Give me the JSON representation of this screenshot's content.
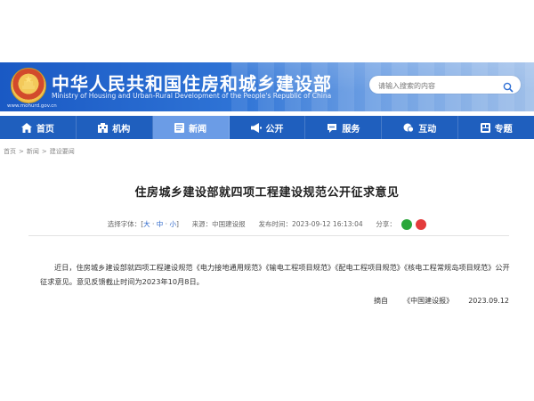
{
  "header": {
    "site_title": "中华人民共和国住房和城乡建设部",
    "site_subtitle": "Ministry of Housing and Urban-Rural Development of the People's Republic of China",
    "site_url": "www.mohurd.gov.cn",
    "search_placeholder": "请输入搜索的内容",
    "search_icon": "search-icon"
  },
  "nav": {
    "items": [
      {
        "label": "首页",
        "icon": "home-icon"
      },
      {
        "label": "机构",
        "icon": "building-icon"
      },
      {
        "label": "新闻",
        "icon": "news-icon",
        "active": true
      },
      {
        "label": "公开",
        "icon": "megaphone-icon"
      },
      {
        "label": "服务",
        "icon": "service-icon"
      },
      {
        "label": "互动",
        "icon": "chat-icon"
      },
      {
        "label": "专题",
        "icon": "topic-icon"
      }
    ]
  },
  "breadcrumb": [
    "首页",
    "新闻",
    "建设要闻"
  ],
  "article": {
    "title": "住房城乡建设部就四项工程建设规范公开征求意见",
    "font_label": "选择字体：",
    "font_sizes": [
      "大",
      "中",
      "小"
    ],
    "source_label": "来源：",
    "source_value": "中国建设报",
    "time_label": "发布时间：",
    "time_value": "2023-09-12 16:13:04",
    "share_label": "分享：",
    "body": "近日，住房城乡建设部就四项工程建设规范《电力接地通用规范》《输电工程项目规范》《配电工程项目规范》《核电工程常规岛项目规范》公开征求意见。意见反馈截止时间为2023年10月8日。",
    "quote_prefix": "摘自",
    "quote_source": "《中国建设报》",
    "quote_date": "2023.09.12"
  },
  "colors": {
    "nav_bg": "#1f5fbe",
    "nav_active": "#6b9ce6",
    "wechat": "#2aa63a",
    "weibo": "#e33b3b"
  }
}
